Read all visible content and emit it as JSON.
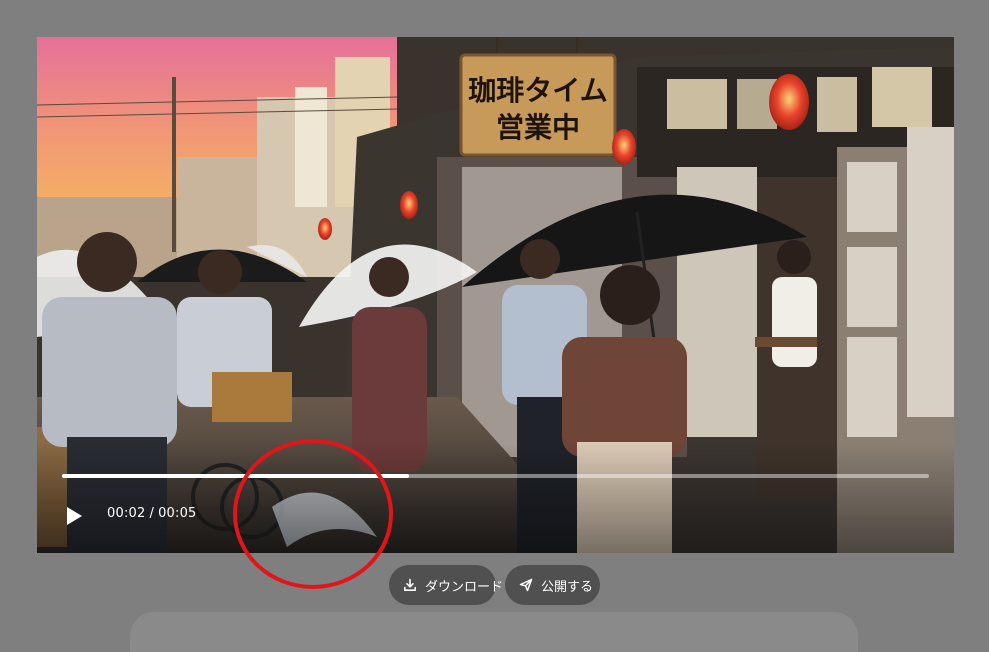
{
  "player": {
    "state": "paused",
    "current_time": "00:02",
    "separator": "/",
    "duration": "00:05",
    "progress": 0.4
  },
  "scene": {
    "sign_line1": "珈琲タイム",
    "sign_line2": "営業中"
  },
  "actions": {
    "download_label": "ダウンロード",
    "publish_label": "公開する"
  },
  "annotation": {
    "color": "#e0161b"
  },
  "icons": {
    "play": "play-icon",
    "download": "download-icon",
    "publish": "send-icon"
  }
}
